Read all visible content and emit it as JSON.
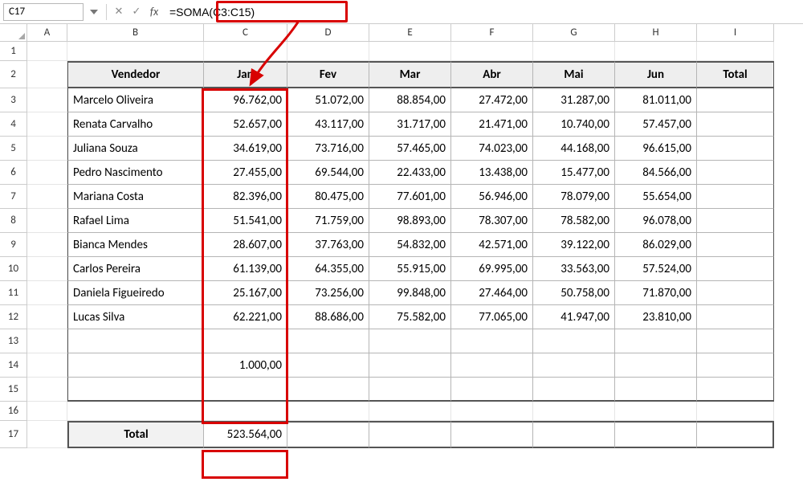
{
  "name_box": "C17",
  "formula": "=SOMA(C3:C15)",
  "fx_label": "fx",
  "col_headers": [
    "A",
    "B",
    "C",
    "D",
    "E",
    "F",
    "G",
    "H",
    "I"
  ],
  "row_headers": [
    "1",
    "2",
    "3",
    "4",
    "5",
    "6",
    "7",
    "8",
    "9",
    "10",
    "11",
    "12",
    "13",
    "14",
    "15",
    "16",
    "17"
  ],
  "headers": {
    "vendedor": "Vendedor",
    "jan": "Jan",
    "fev": "Fev",
    "mar": "Mar",
    "abr": "Abr",
    "mai": "Mai",
    "jun": "Jun",
    "total": "Total"
  },
  "rows": [
    {
      "name": "Marcelo Oliveira",
      "jan": "96.762,00",
      "fev": "51.072,00",
      "mar": "88.854,00",
      "abr": "27.472,00",
      "mai": "31.287,00",
      "jun": "81.011,00"
    },
    {
      "name": "Renata Carvalho",
      "jan": "52.657,00",
      "fev": "43.117,00",
      "mar": "31.717,00",
      "abr": "21.471,00",
      "mai": "10.740,00",
      "jun": "57.457,00"
    },
    {
      "name": "Juliana Souza",
      "jan": "34.619,00",
      "fev": "73.716,00",
      "mar": "57.465,00",
      "abr": "74.023,00",
      "mai": "44.168,00",
      "jun": "96.615,00"
    },
    {
      "name": "Pedro Nascimento",
      "jan": "27.455,00",
      "fev": "69.544,00",
      "mar": "22.433,00",
      "abr": "13.438,00",
      "mai": "15.477,00",
      "jun": "84.566,00"
    },
    {
      "name": "Mariana Costa",
      "jan": "82.396,00",
      "fev": "80.475,00",
      "mar": "77.601,00",
      "abr": "56.946,00",
      "mai": "78.079,00",
      "jun": "55.654,00"
    },
    {
      "name": "Rafael Lima",
      "jan": "51.541,00",
      "fev": "71.759,00",
      "mar": "98.893,00",
      "abr": "78.307,00",
      "mai": "78.582,00",
      "jun": "96.078,00"
    },
    {
      "name": "Bianca Mendes",
      "jan": "28.607,00",
      "fev": "37.763,00",
      "mar": "54.832,00",
      "abr": "42.571,00",
      "mai": "39.122,00",
      "jun": "86.029,00"
    },
    {
      "name": "Carlos Pereira",
      "jan": "61.139,00",
      "fev": "64.355,00",
      "mar": "55.915,00",
      "abr": "69.995,00",
      "mai": "33.563,00",
      "jun": "57.524,00"
    },
    {
      "name": "Daniela Figueiredo",
      "jan": "25.167,00",
      "fev": "73.256,00",
      "mar": "99.848,00",
      "abr": "27.464,00",
      "mai": "50.758,00",
      "jun": "71.870,00"
    },
    {
      "name": "Lucas Silva",
      "jan": "62.221,00",
      "fev": "88.686,00",
      "mar": "75.582,00",
      "abr": "77.065,00",
      "mai": "41.947,00",
      "jun": "23.810,00"
    }
  ],
  "extra_row_14_jan": "1.000,00",
  "total_label": "Total",
  "total_jan": "523.564,00"
}
